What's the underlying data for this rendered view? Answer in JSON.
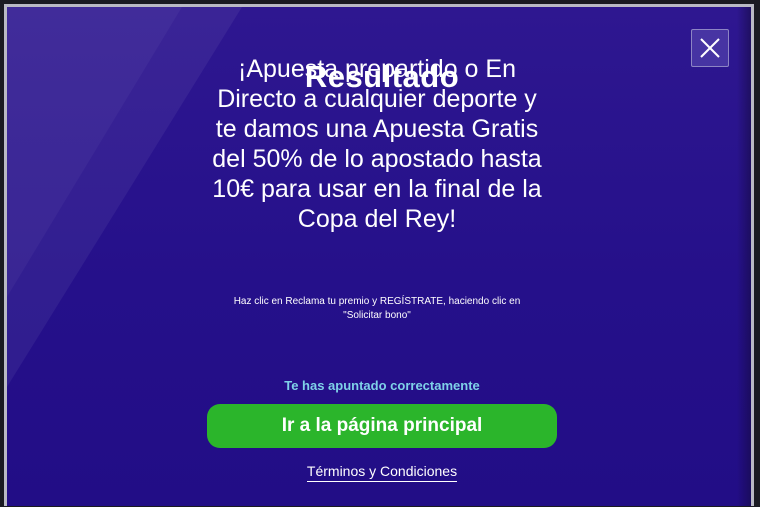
{
  "modal": {
    "title": "Resultado",
    "headline": "¡Apuesta prepartido o En Directo a cualquier deporte y te damos una Apuesta Gratis del 50% de lo apostado hasta 10€ para usar en la final de la Copa del Rey!",
    "instructions_line1": "Haz clic en Reclama tu premio y REGÍSTRATE, haciendo clic en",
    "instructions_line2": "\"Solicitar bono\"",
    "success_message": "Te has apuntado correctamente",
    "cta_label": "Ir a la página principal",
    "terms_label": "Términos y Condiciones",
    "close_icon": "close-icon"
  },
  "colors": {
    "background": "#25108a",
    "cta": "#2bb52b",
    "success_text": "#7fd1e8"
  }
}
